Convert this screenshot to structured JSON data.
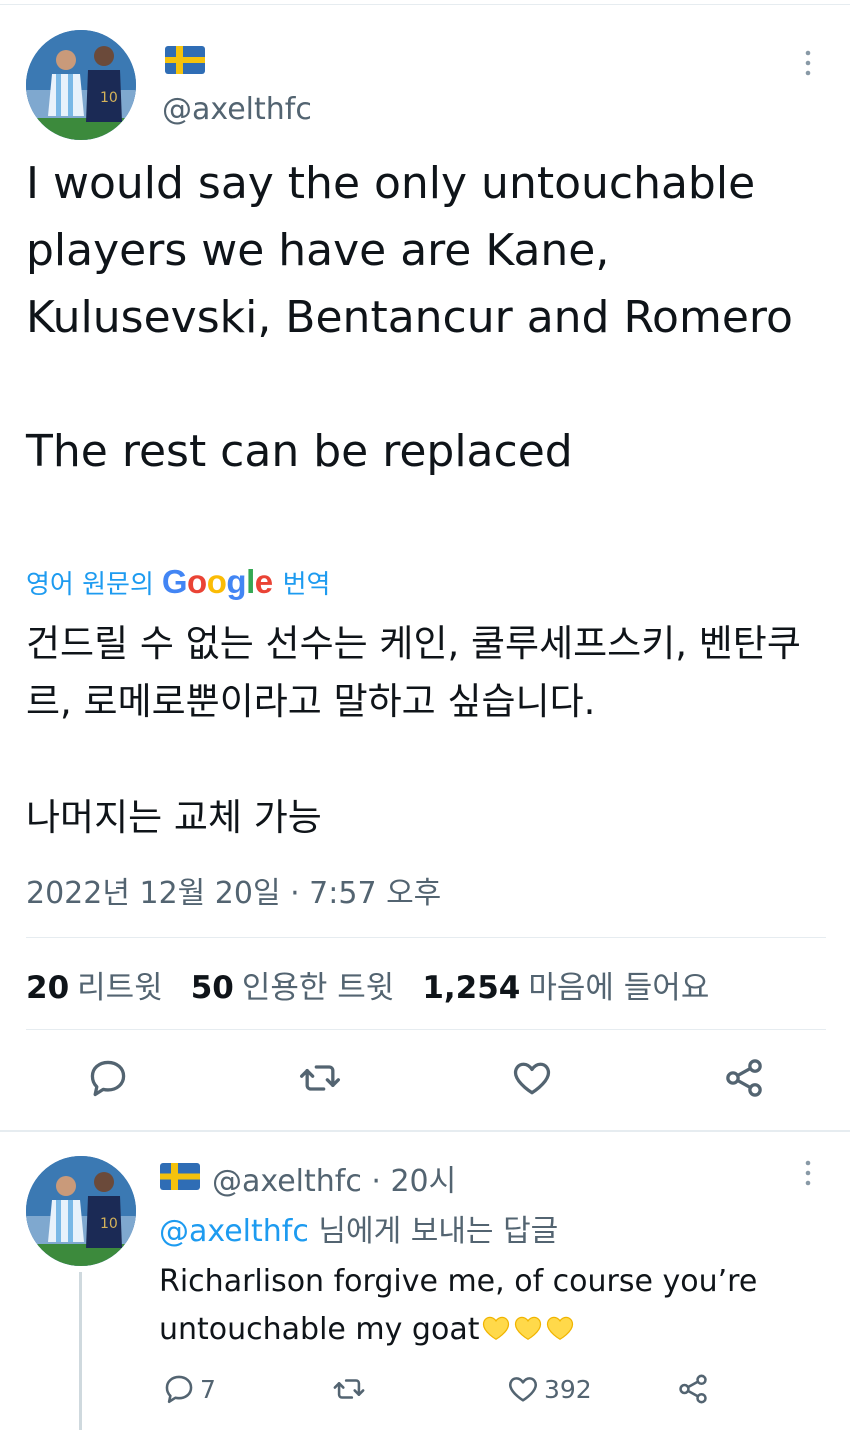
{
  "tweet": {
    "author_handle": "@axelthfc",
    "author_flag": "sweden-flag",
    "text": "I would say the only untouchable players we have are Kane, Kulusevski, Bentancur and Romero\n\nThe rest can be replaced",
    "translation": {
      "prefix": "영어 원문의",
      "provider": "Google",
      "suffix": "번역",
      "text": "건드릴 수 없는 선수는 케인, 쿨루세프스키, 벤탄쿠르, 로메로뿐이라고 말하고 싶습니다.\n\n나머지는 교체 가능"
    },
    "timestamp": "2022년 12월 20일 · 7:57 오후",
    "stats": [
      {
        "count": "20",
        "label": "리트윗"
      },
      {
        "count": "50",
        "label": "인용한 트윗"
      },
      {
        "count": "1,254",
        "label": "마음에 들어요"
      }
    ],
    "actions": [
      "reply-icon",
      "retweet-icon",
      "like-icon",
      "share-icon"
    ]
  },
  "reply": {
    "author_handle": "@axelthfc",
    "time_ago": "· 20시",
    "reply_to_handle": "@axelthfc",
    "reply_to_suffix": "님에게 보내는 답글",
    "text": "Richarlison forgive me, of course you’re untouchable my goat",
    "emoji": [
      "yellow-heart",
      "yellow-heart",
      "yellow-heart"
    ],
    "reply_count": "7",
    "like_count": "392"
  },
  "colors": {
    "accent": "#1d9bf0",
    "secondary_text": "#536471",
    "primary_text": "#0f1419",
    "divider": "#e6ecf0"
  }
}
